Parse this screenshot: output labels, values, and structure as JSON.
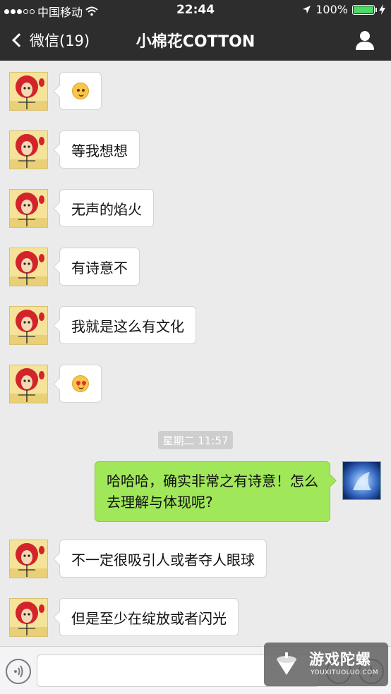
{
  "status_bar": {
    "carrier": "中国移动",
    "time": "22:44",
    "battery_percent": "100%",
    "signal_dots_filled": 3,
    "signal_dots_total": 5
  },
  "nav": {
    "back_label": "微信(19)",
    "title": "小棉花COTTON",
    "profile_icon": "person-icon"
  },
  "messages": [
    {
      "side": "left",
      "type": "emoji",
      "emoji": "blushing-face"
    },
    {
      "side": "left",
      "type": "text",
      "text": "等我想想"
    },
    {
      "side": "left",
      "type": "text",
      "text": "无声的焰火"
    },
    {
      "side": "left",
      "type": "text",
      "text": "有诗意不"
    },
    {
      "side": "left",
      "type": "text",
      "text": "我就是这么有文化"
    },
    {
      "side": "left",
      "type": "emoji",
      "emoji": "heart-eyes-face"
    },
    {
      "side": "right",
      "type": "text",
      "text": "哈哈哈，确实非常之有诗意！怎么\n去理解与体现呢?"
    },
    {
      "side": "left",
      "type": "text",
      "text": "不一定很吸引人或者夺人眼球"
    },
    {
      "side": "left",
      "type": "text",
      "text": "但是至少在绽放或者闪光"
    }
  ],
  "timestamp": "星期二 11:57",
  "input_bar": {
    "voice_icon": "voice-icon",
    "emoji_icon": "emoji-icon",
    "plus_icon": "plus-icon"
  },
  "watermark": {
    "cn": "游戏陀螺",
    "en": "YOUXITUOLUO.COM"
  },
  "colors": {
    "header_bg": "#2d2d2d",
    "chat_bg": "#ebebeb",
    "sent_bubble": "#a0e75a",
    "received_bubble": "#ffffff"
  }
}
